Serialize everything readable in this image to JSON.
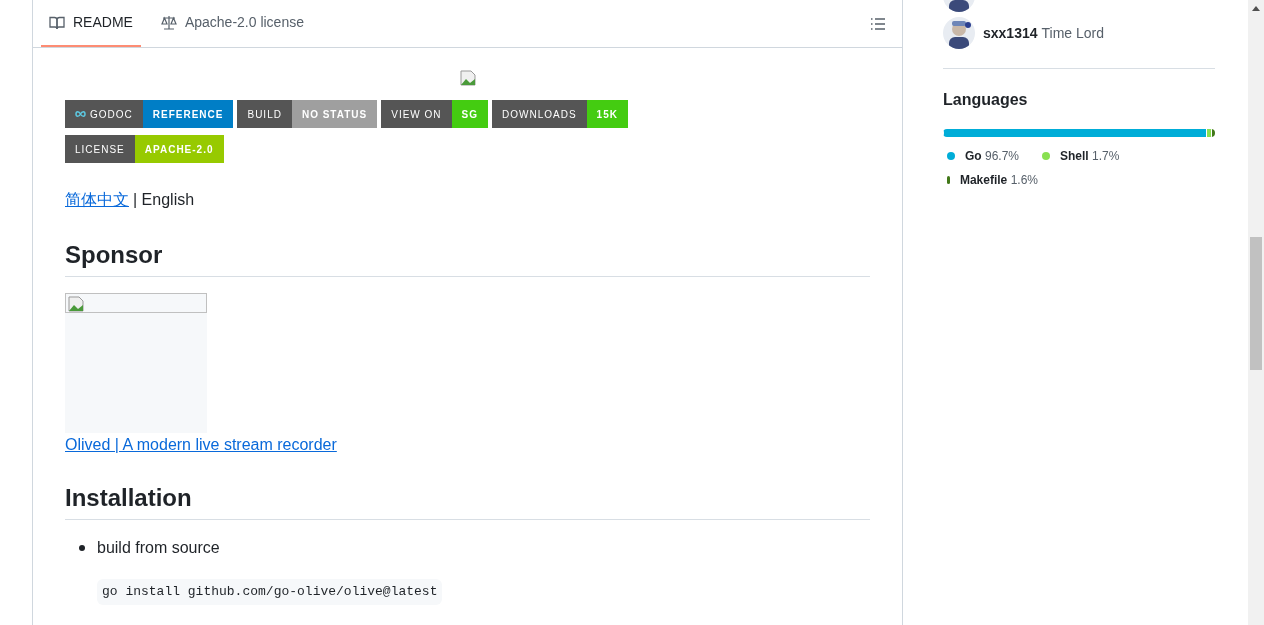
{
  "tabs": [
    {
      "label": "README",
      "selected": true,
      "kind": "book"
    },
    {
      "label": "Apache-2.0 license",
      "selected": false,
      "kind": "scale"
    }
  ],
  "readme": {
    "badges": [
      {
        "label": "GODOC",
        "value": "REFERENCE",
        "color": "#007ec6",
        "kind": "godoc"
      },
      {
        "label": "BUILD",
        "value": "NO STATUS",
        "color": "#9f9f9f",
        "kind": "plain"
      },
      {
        "label": "VIEW ON",
        "value": "SG",
        "color": "#4c1",
        "kind": "plain"
      },
      {
        "label": "DOWNLOADS",
        "value": "15K",
        "color": "#44cc11",
        "kind": "plain"
      },
      {
        "label": "LICENSE",
        "value": "APACHE-2.0",
        "color": "#97ca00",
        "kind": "plain"
      }
    ],
    "language_links": [
      {
        "text": "简体中文",
        "kind": "link"
      },
      {
        "text": "| English",
        "kind": "text"
      }
    ],
    "sections": [
      {
        "heading": "Sponsor",
        "sponsor_link": "Olived | A modern live stream recorder"
      },
      {
        "heading": "Installation",
        "bullet": "build from source",
        "code": "go install github.com/go-olive/olive@latest"
      }
    ]
  },
  "sidebar": {
    "contributors": [
      {
        "kind": "picture"
      },
      {
        "kind": "picture",
        "name": "sxx1314",
        "title": "Time Lord"
      }
    ],
    "languages": {
      "title": "Languages",
      "items": [
        {
          "name": "Go",
          "percent": "96.7%",
          "level": 0.967,
          "color": "#00add8"
        },
        {
          "name": "Shell",
          "percent": "1.7%",
          "level": 0.017,
          "color": "#89e051"
        },
        {
          "name": "Makefile",
          "percent": "1.6%",
          "level": 0.016,
          "color": "#427819"
        }
      ]
    }
  }
}
